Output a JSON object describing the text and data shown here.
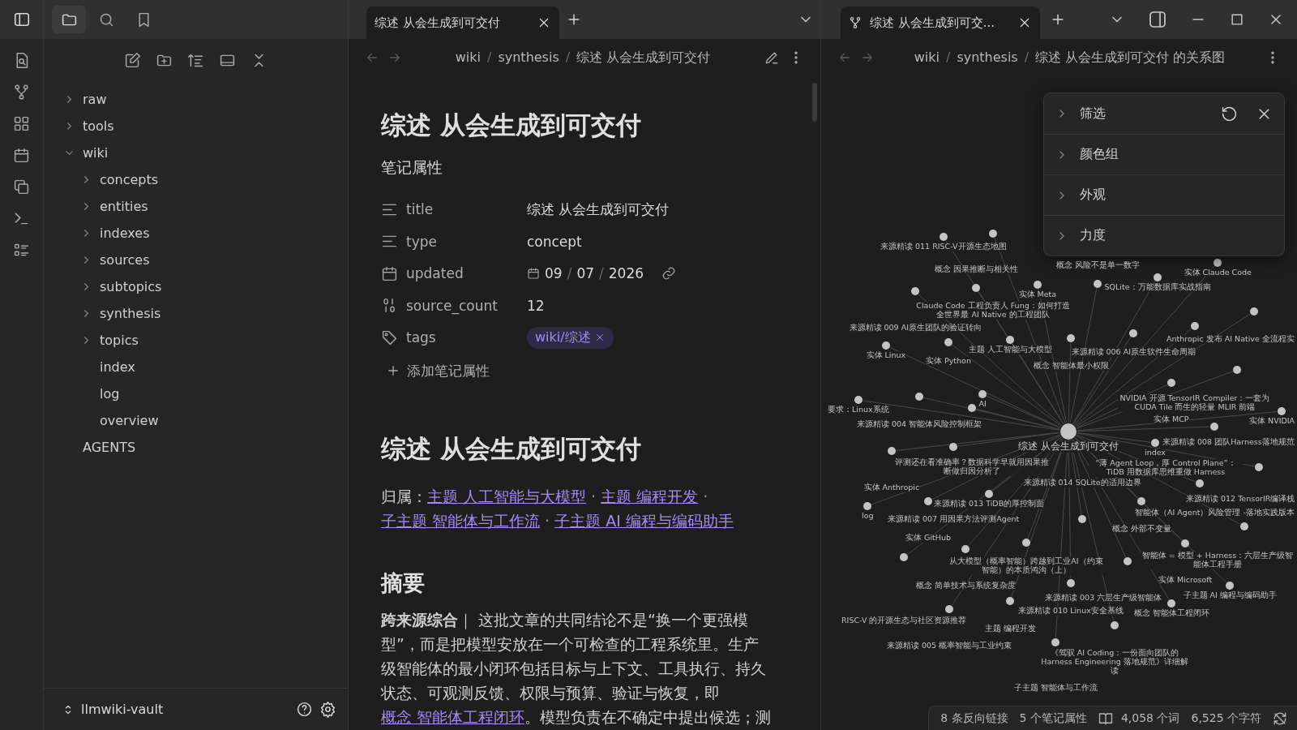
{
  "sidebar_tabs": [
    {
      "kind": "files",
      "selected": true
    },
    {
      "kind": "search",
      "selected": false
    },
    {
      "kind": "bookmarks",
      "selected": false
    }
  ],
  "file_tree": [
    {
      "name": "raw",
      "kind": "folder",
      "expanded": false
    },
    {
      "name": "tools",
      "kind": "folder",
      "expanded": false
    },
    {
      "name": "wiki",
      "kind": "folder",
      "expanded": true,
      "children": [
        {
          "name": "concepts",
          "kind": "folder",
          "expanded": false
        },
        {
          "name": "entities",
          "kind": "folder",
          "expanded": false
        },
        {
          "name": "indexes",
          "kind": "folder",
          "expanded": false
        },
        {
          "name": "sources",
          "kind": "folder",
          "expanded": false
        },
        {
          "name": "subtopics",
          "kind": "folder",
          "expanded": false
        },
        {
          "name": "synthesis",
          "kind": "folder",
          "expanded": false
        },
        {
          "name": "topics",
          "kind": "folder",
          "expanded": false
        },
        {
          "name": "index",
          "kind": "file"
        },
        {
          "name": "log",
          "kind": "file"
        },
        {
          "name": "overview",
          "kind": "file"
        }
      ]
    },
    {
      "name": "AGENTS",
      "kind": "file"
    }
  ],
  "vault": {
    "name": "llmwiki-vault"
  },
  "note_tab": {
    "title": "综述 从会生成到可交付",
    "selected": true
  },
  "note": {
    "breadcrumb": [
      "wiki",
      "synthesis",
      "综述 从会生成到可交付"
    ],
    "breadcrumb_separator": "/",
    "title": "综述 从会生成到可交付",
    "properties_heading": "笔记属性",
    "properties": [
      {
        "kind": "text",
        "name": "title",
        "value": "综述 从会生成到可交付"
      },
      {
        "kind": "text",
        "name": "type",
        "value": "concept"
      },
      {
        "kind": "date",
        "name": "updated",
        "date_parts": [
          "09",
          "07",
          "2026"
        ],
        "separator": "/"
      },
      {
        "kind": "number",
        "name": "source_count",
        "value": "12"
      },
      {
        "kind": "tags",
        "name": "tags",
        "tags": [
          "wiki/综述"
        ]
      }
    ],
    "add_property": "添加笔记属性",
    "heading": "综述 从会生成到可交付",
    "belongs": {
      "label": "归属：",
      "separator": "·",
      "links": [
        "主题 人工智能与大模型",
        "主题 编程开发",
        "子主题 智能体与工作流",
        "子主题 AI 编程与编码助手"
      ]
    },
    "summary_heading": "摘要",
    "paragraph": [
      {
        "kind": "text",
        "text": "**跨来源综合**｜ 这批文章的共同结论不是“换一个更强模型”，而是把模型安放在一个可检查的工程系统里。生产级智能体的最小闭环包括目标与上下文、工具执行、持久状态、可观测反馈、权限与预算、验证与恢复，即 "
      },
      {
        "kind": "link",
        "text": "概念 智能体工程闭环"
      },
      {
        "kind": "text",
        "text": "。模型负责在不确定中提出候选；测"
      }
    ]
  },
  "graph_tab": {
    "title": "综述 从会生成到可交...",
    "selected": true
  },
  "graph": {
    "breadcrumb": [
      "wiki",
      "synthesis",
      "综述 从会生成到可交付 的关系图"
    ],
    "breadcrumb_separator": "/",
    "controls": [
      {
        "label": "筛选",
        "expanded": false
      },
      {
        "label": "颜色组",
        "expanded": false
      },
      {
        "label": "外观",
        "expanded": false
      },
      {
        "label": "力度",
        "expanded": false
      }
    ],
    "center": "综述 从会生成到可交付",
    "nodes": [
      {
        "label": "来源精读 011 RISC-V开源生态地图"
      },
      {
        "label": "Claude Code 工程负责人 Fung：如何打造全世界最 AI Native 的工程团队"
      },
      {
        "label": "实体 Claude Code"
      },
      {
        "label": "SQLite：万能数据库实战指南"
      },
      {
        "label": "来源精读 009 AI原生团队的验证转向"
      },
      {
        "label": "概念 因果推断与相关性"
      },
      {
        "label": "实体 Meta"
      },
      {
        "label": "概念 风险不是单一数字"
      },
      {
        "label": "Anthropic 发布 AI Native 全流程实"
      },
      {
        "label": "NVIDIA 开源 TensorIR Compiler：一套为 CUDA Tile 而生的轻量 MLIR 前端"
      },
      {
        "label": "来源精读 006 AI原生软件生命周期"
      },
      {
        "label": "概念 智能体最小权限"
      },
      {
        "label": "主题 人工智能与大模型"
      },
      {
        "label": "实体 Linux"
      },
      {
        "label": "实体 Python"
      },
      {
        "label": "实体 MCP"
      },
      {
        "label": "来源精读 008 团队Harness落地规范"
      },
      {
        "label": "要求：Linux系统"
      },
      {
        "label": "来源精读 004 智能体风险控制框架"
      },
      {
        "label": "AI"
      },
      {
        "label": "评测还在看准确率？数据科学早就用因果推断做归因分析了"
      },
      {
        "label": "实体 NVIDIA"
      },
      {
        "label": "“薄 Agent Loop，厚 Control Plane”：TiDB 用数据库思维重做 Harness"
      },
      {
        "label": "index"
      },
      {
        "label": "实体 Anthropic"
      },
      {
        "label": "来源精读 007 用因果方法评测Agent"
      },
      {
        "label": "智能体（AI Agent）风险管理 -落地实践版本"
      },
      {
        "label": "智能体 = 模型 + Harness：六层生产级智能体工程手册"
      },
      {
        "label": "log"
      },
      {
        "label": "实体 GitHub"
      },
      {
        "label": "来源精读 013 TiDB的厚控制面"
      },
      {
        "label": "概念 外部不变量"
      },
      {
        "label": "来源精读 014 SQLite的适用边界"
      },
      {
        "label": "来源精读 012 TensorIR编译栈"
      },
      {
        "label": "从大模型（概率智能）跨越到工业AI（约束智能）的本质鸿沟（上）"
      },
      {
        "label": "概念 简单技术与系统复杂度"
      },
      {
        "label": "RISC-V 的开源生态与社区资源推荐"
      },
      {
        "label": "实体 Microsoft"
      },
      {
        "label": "来源精读 003 六层生产级智能体"
      },
      {
        "label": "来源精读 010 Linux安全基线"
      },
      {
        "label": "子主题 AI 编程与编码助手"
      },
      {
        "label": "主题 编程开发"
      },
      {
        "label": "来源精读 005 概率智能与工业约束"
      },
      {
        "label": "概念 智能体工程闭环"
      },
      {
        "label": "《驾驭 AI Coding：一份面向团队的 Harness Engineering 落地规范》详细解读"
      },
      {
        "label": "子主题 智能体与工作流"
      }
    ]
  },
  "status_bar": [
    {
      "kind": "backlinks",
      "text": "8 条反向链接"
    },
    {
      "kind": "properties",
      "text": "5 个笔记属性"
    },
    {
      "kind": "words",
      "text": "4,058 个词"
    },
    {
      "kind": "characters",
      "text": "6,525 个字符"
    }
  ]
}
